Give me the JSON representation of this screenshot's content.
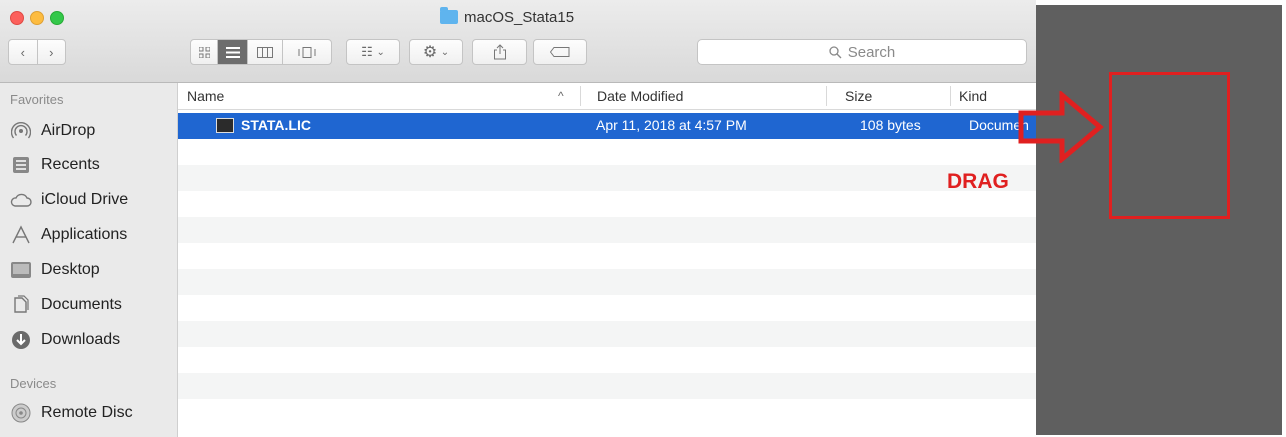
{
  "window": {
    "title": "macOS_Stata15"
  },
  "toolbar": {
    "back_icon": "chevron-left",
    "forward_icon": "chevron-right",
    "view_icons": [
      "icon-view",
      "list-view",
      "column-view",
      "cover-flow-view"
    ],
    "group_icon": "group-menu",
    "action_icon": "gear",
    "share_icon": "share",
    "tags_icon": "tag",
    "search_placeholder": "Search"
  },
  "sidebar": {
    "favorites_header": "Favorites",
    "favorites": [
      {
        "label": "AirDrop",
        "icon": "airdrop"
      },
      {
        "label": "Recents",
        "icon": "recents"
      },
      {
        "label": "iCloud Drive",
        "icon": "cloud"
      },
      {
        "label": "Applications",
        "icon": "applications"
      },
      {
        "label": "Desktop",
        "icon": "desktop"
      },
      {
        "label": "Documents",
        "icon": "documents"
      },
      {
        "label": "Downloads",
        "icon": "downloads"
      }
    ],
    "devices_header": "Devices",
    "devices": [
      {
        "label": "Remote Disc",
        "icon": "disc"
      }
    ]
  },
  "list": {
    "columns": {
      "name": "Name",
      "sort_indicator": "^",
      "date": "Date Modified",
      "size": "Size",
      "kind": "Kind"
    },
    "files": [
      {
        "name": "STATA.LIC",
        "date": "Apr 11, 2018 at 4:57 PM",
        "size": "108 bytes",
        "kind": "Documen"
      }
    ]
  },
  "annotation": {
    "drag_label": "DRAG",
    "color": "#e02020"
  }
}
